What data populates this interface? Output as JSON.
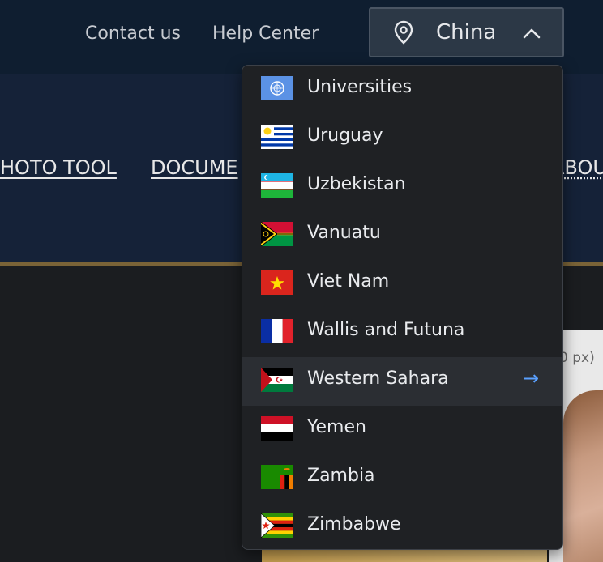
{
  "header": {
    "contact_label": "Contact us",
    "help_label": "Help Center",
    "country_selector": {
      "value": "China",
      "pin_icon": "location-pin-icon",
      "chevron_icon": "chevron-up-icon"
    }
  },
  "nav": {
    "items": [
      "HOTO TOOL",
      "DOCUME",
      "ABOU"
    ]
  },
  "background": {
    "photo_dimension_label": "0 px)"
  },
  "dropdown": {
    "options": [
      {
        "label": "Universities",
        "flag": "un"
      },
      {
        "label": "Uruguay",
        "flag": "uy"
      },
      {
        "label": "Uzbekistan",
        "flag": "uz"
      },
      {
        "label": "Vanuatu",
        "flag": "vu"
      },
      {
        "label": "Viet Nam",
        "flag": "vn"
      },
      {
        "label": "Wallis and Futuna",
        "flag": "wf"
      },
      {
        "label": "Western Sahara",
        "flag": "eh",
        "hovered": true,
        "arrow": "→"
      },
      {
        "label": "Yemen",
        "flag": "ye"
      },
      {
        "label": "Zambia",
        "flag": "zm"
      },
      {
        "label": "Zimbabwe",
        "flag": "zw"
      }
    ]
  },
  "colors": {
    "accent_arrow": "#5aa0ff",
    "gold_bar": "#7a6337",
    "nav_bg": "#152238",
    "topbar_bg": "#0f1e30"
  }
}
